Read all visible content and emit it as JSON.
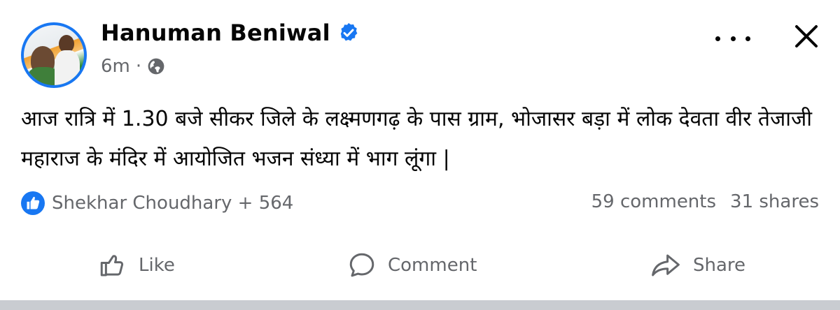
{
  "post": {
    "author": "Hanuman Beniwal",
    "time": "6m",
    "separator": "·",
    "text": "आज रात्रि में 1.30 बजे सीकर जिले के लक्ष्मणगढ़ के पास ग्राम, भोजासर बड़ा में लोक देवता वीर तेजाजी महाराज के मंदिर में आयोजित भजन संध्या में भाग लूंगा |",
    "reactions": "Shekhar Choudhary + 564",
    "comments": "59 comments",
    "shares": "31 shares"
  },
  "actions": {
    "like": "Like",
    "comment": "Comment",
    "share": "Share"
  },
  "icons": {
    "verified": "verified-badge-icon",
    "audience": "globe-icon",
    "more": "more-options-icon",
    "close": "close-icon",
    "reaction": "like-reaction-icon"
  },
  "colors": {
    "brand": "#1877f2",
    "secondary_text": "#65676b",
    "primary_text": "#050505"
  }
}
